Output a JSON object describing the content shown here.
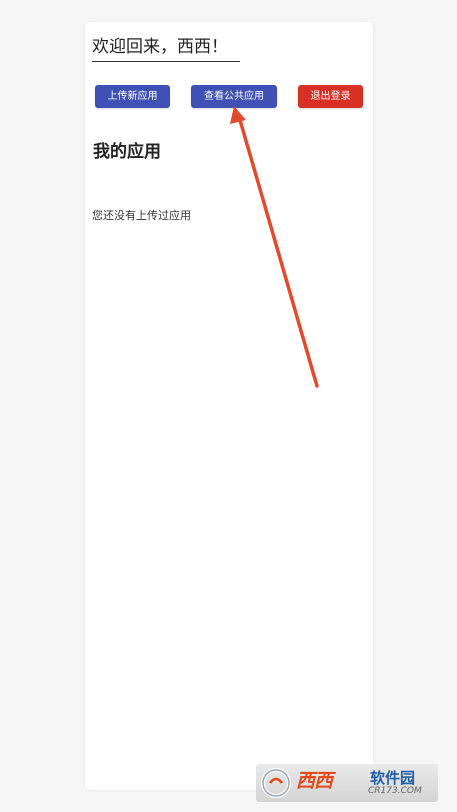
{
  "header": {
    "welcome_text": "欢迎回来，西西！"
  },
  "toolbar": {
    "upload_label": "上传新应用",
    "public_label": "查看公共应用",
    "logout_label": "退出登录"
  },
  "main": {
    "title": "我的应用",
    "empty_message": "您还没有上传过应用"
  },
  "watermark": {
    "name": "西西",
    "tagline": "软件园",
    "url": "CR173.COM"
  },
  "colors": {
    "primary": "#3f51b5",
    "danger": "#d93025",
    "annotation_arrow": "#e04a2f",
    "background": "#f5f5f5",
    "card": "#ffffff"
  }
}
